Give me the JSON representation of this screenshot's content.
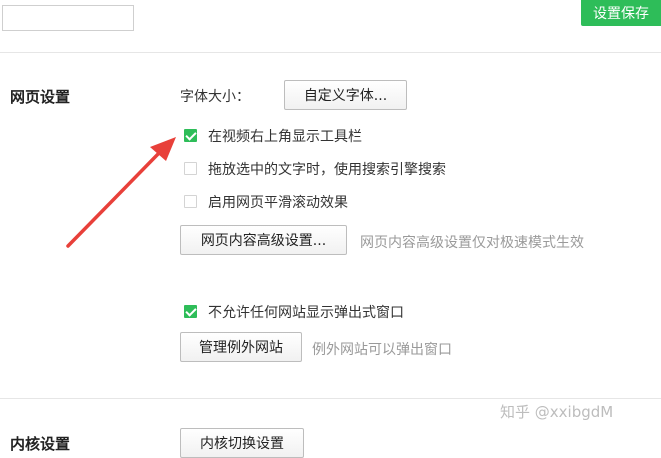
{
  "top_bar": {
    "search_value": "",
    "save_label": "设置保存"
  },
  "web_settings": {
    "title": "网页设置",
    "font_size_label": "字体大小：",
    "custom_font_button": "自定义字体...",
    "options": [
      {
        "label": "在视频右上角显示工具栏",
        "checked": true
      },
      {
        "label": "拖放选中的文字时，使用搜索引擎搜索",
        "checked": false
      },
      {
        "label": "启用网页平滑滚动效果",
        "checked": false
      }
    ],
    "advanced_button": "网页内容高级设置...",
    "advanced_hint": "网页内容高级设置仅对极速模式生效",
    "popup_option": {
      "label": "不允许任何网站显示弹出式窗口",
      "checked": true
    },
    "manage_exceptions_button": "管理例外网站",
    "exceptions_hint": "例外网站可以弹出窗口"
  },
  "kernel_settings": {
    "title": "内核设置",
    "switch_button": "内核切换设置"
  },
  "watermark": "知乎 @xxibgdM",
  "colors": {
    "accent_green": "#2ebd59",
    "arrow_red": "#e8403a"
  }
}
